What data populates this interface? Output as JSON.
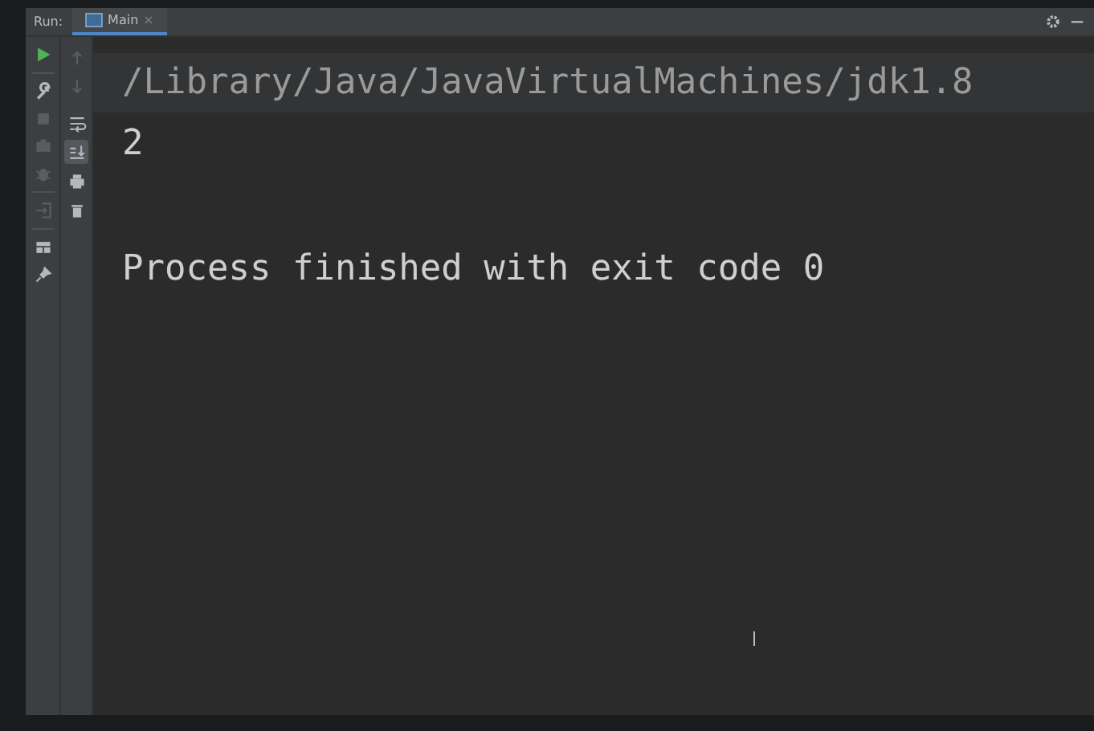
{
  "panel": {
    "title": "Run:"
  },
  "tabs": [
    {
      "label": "Main",
      "selected": true,
      "close": "×"
    }
  ],
  "run_toolbar": [
    {
      "kind": "rerun",
      "disabled": false
    },
    {
      "kind": "wrench",
      "disabled": false
    },
    {
      "kind": "stop",
      "disabled": true
    },
    {
      "kind": "camera",
      "disabled": true
    },
    {
      "kind": "bug",
      "disabled": true
    },
    {
      "kind": "exit",
      "disabled": true
    },
    {
      "kind": "layout",
      "disabled": false
    },
    {
      "kind": "pin",
      "disabled": false
    }
  ],
  "console_toolbar": [
    {
      "kind": "up",
      "disabled": true,
      "on": false
    },
    {
      "kind": "down",
      "disabled": true,
      "on": false
    },
    {
      "kind": "wrap",
      "disabled": false,
      "on": false
    },
    {
      "kind": "scroll-end",
      "disabled": false,
      "on": true
    },
    {
      "kind": "print",
      "disabled": false,
      "on": false
    },
    {
      "kind": "trash",
      "disabled": false,
      "on": false
    }
  ],
  "console": [
    {
      "text": "/Library/Java/JavaVirtualMachines/jdk1.8",
      "kind": "command"
    },
    {
      "text": "2",
      "kind": "output"
    },
    {
      "kind": "blank"
    },
    {
      "text": "Process finished with exit code 0",
      "kind": "output"
    }
  ]
}
